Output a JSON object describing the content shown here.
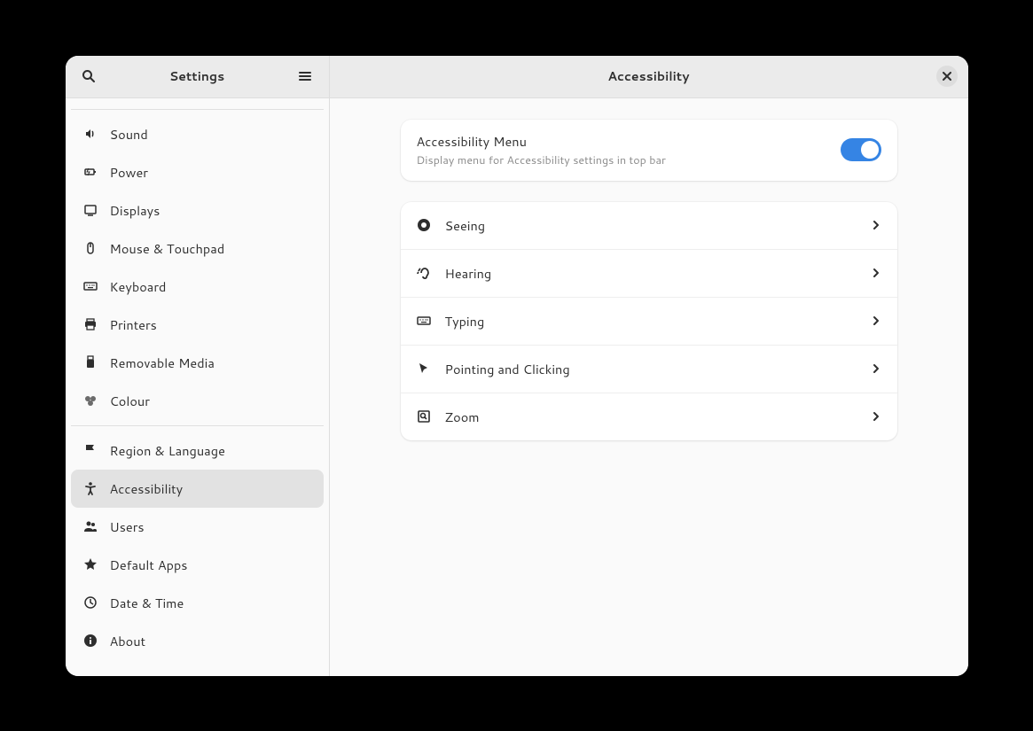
{
  "sidebar": {
    "title": "Settings",
    "group1": [
      {
        "label": "Sound"
      },
      {
        "label": "Power"
      },
      {
        "label": "Displays"
      },
      {
        "label": "Mouse & Touchpad"
      },
      {
        "label": "Keyboard"
      },
      {
        "label": "Printers"
      },
      {
        "label": "Removable Media"
      },
      {
        "label": "Colour"
      }
    ],
    "group2": [
      {
        "label": "Region & Language"
      },
      {
        "label": "Accessibility"
      },
      {
        "label": "Users"
      },
      {
        "label": "Default Apps"
      },
      {
        "label": "Date & Time"
      },
      {
        "label": "About"
      }
    ]
  },
  "main": {
    "title": "Accessibility",
    "toggle": {
      "title": "Accessibility Menu",
      "subtitle": "Display menu for Accessibility settings in top bar",
      "enabled": true
    },
    "categories": [
      {
        "label": "Seeing"
      },
      {
        "label": "Hearing"
      },
      {
        "label": "Typing"
      },
      {
        "label": "Pointing and Clicking"
      },
      {
        "label": "Zoom"
      }
    ]
  }
}
